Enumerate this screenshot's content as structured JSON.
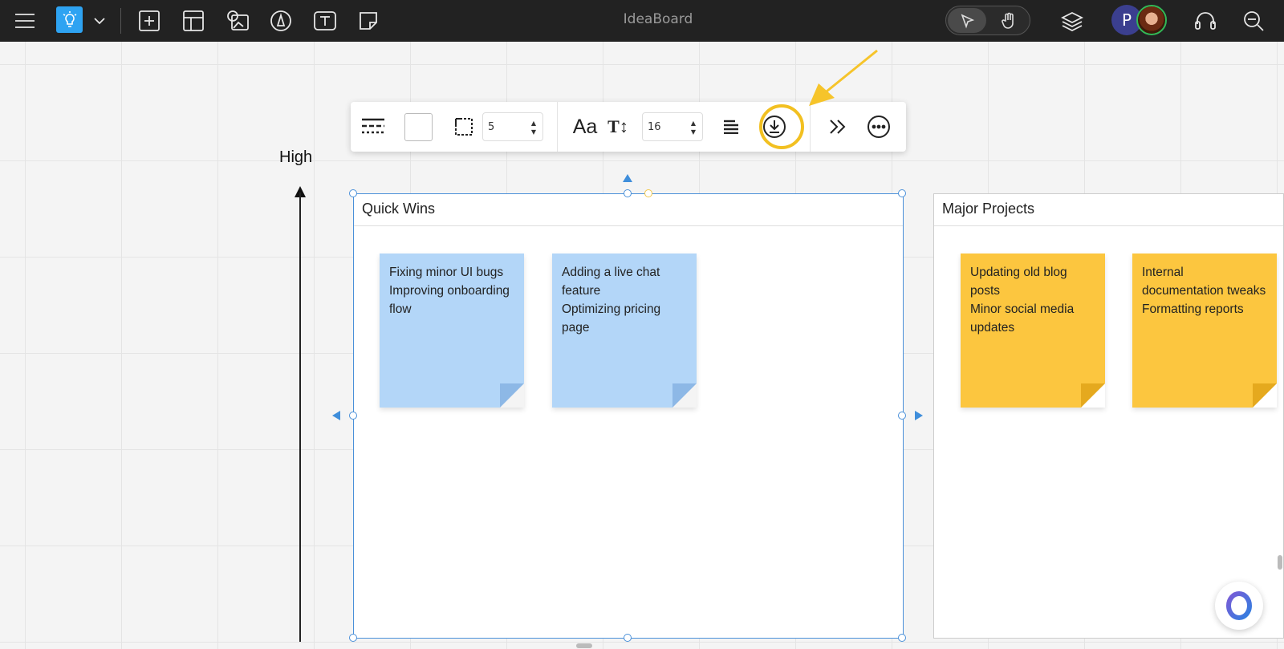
{
  "app": {
    "title": "IdeaBoard"
  },
  "topbar": {
    "icons": [
      "hamburger-icon",
      "lightbulb-icon",
      "chevron-down-icon",
      "add-frame-icon",
      "template-icon",
      "media-icon",
      "pen-icon",
      "text-icon",
      "sticky-note-icon",
      "pointer-icon",
      "hand-icon",
      "layers-icon",
      "headset-icon",
      "zoom-out-icon"
    ],
    "user_initial": "P"
  },
  "toolbar": {
    "border_width": "5",
    "font_size": "16",
    "font_label": "Aa",
    "text_size_label": "T↕",
    "icons": [
      "line-style-icon",
      "fill-color-swatch",
      "border-style-icon",
      "font-icon",
      "text-size-icon",
      "align-icon",
      "download-icon",
      "more-forward-icon",
      "more-options-icon"
    ],
    "highlight_color": "#f2c021"
  },
  "axis": {
    "label": "High"
  },
  "frames": [
    {
      "title": "Quick Wins",
      "notes": [
        {
          "color": "#b3d6f8",
          "lines": [
            "Fixing minor UI bugs",
            "Improving onboarding flow"
          ]
        },
        {
          "color": "#b3d6f8",
          "lines": [
            "Adding a live chat feature",
            "Optimizing pricing page"
          ]
        }
      ]
    },
    {
      "title": "Major Projects",
      "notes": [
        {
          "color": "#fcc63f",
          "lines": [
            "Updating old blog posts",
            "Minor social media updates"
          ]
        },
        {
          "color": "#fcc63f",
          "lines": [
            "Internal documentation tweaks",
            "Formatting reports"
          ]
        }
      ]
    }
  ],
  "colors": {
    "selection": "#4a90d9",
    "accent": "#2ea3f2"
  }
}
